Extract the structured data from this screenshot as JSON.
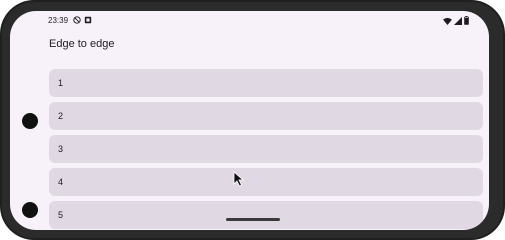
{
  "status_bar": {
    "time": "23:39",
    "left_icons": [
      "do-not-disturb-icon",
      "notification-icon"
    ],
    "right_icons": [
      "wifi-icon",
      "signal-icon",
      "battery-icon"
    ]
  },
  "app": {
    "title": "Edge to edge"
  },
  "list": {
    "items": [
      {
        "label": "1"
      },
      {
        "label": "2"
      },
      {
        "label": "3"
      },
      {
        "label": "4"
      },
      {
        "label": "5"
      }
    ]
  },
  "colors": {
    "background": "#f7f2fa",
    "item_background": "#e0d9e3",
    "text": "#1d1b20",
    "device_frame": "#1f1f1f"
  }
}
